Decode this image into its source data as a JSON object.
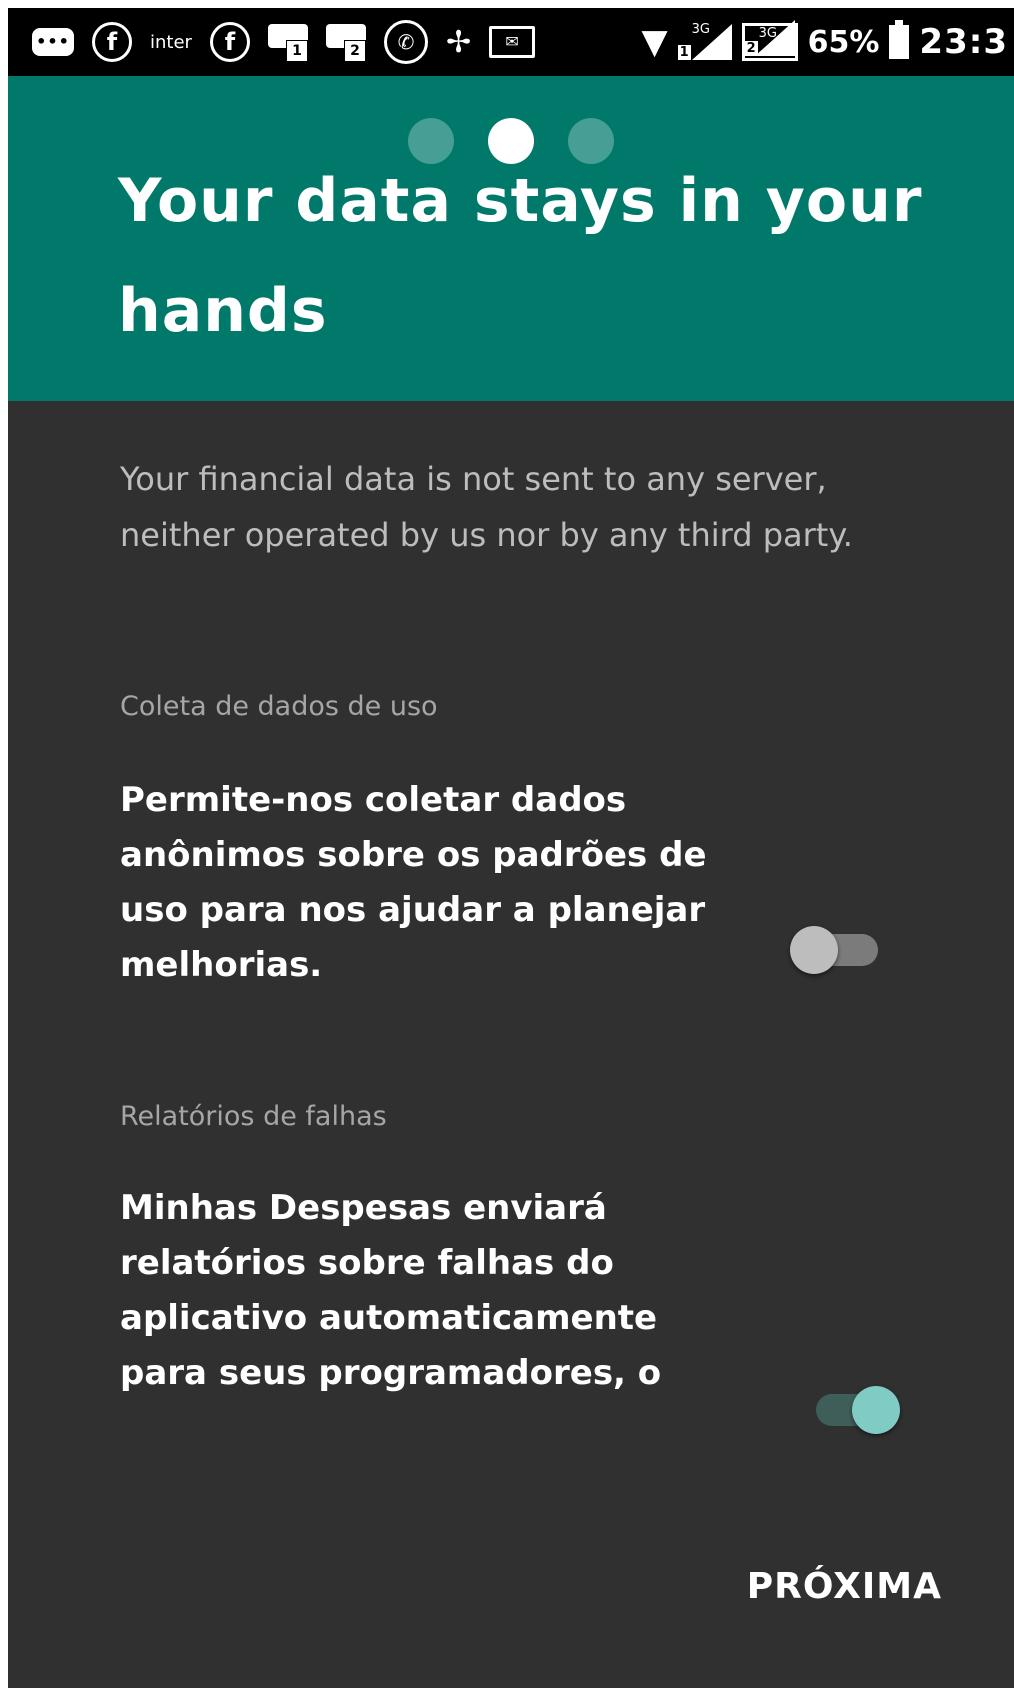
{
  "status_bar": {
    "icons_left": [
      "chat-bubble-icon",
      "facebook-icon",
      "inter-icon",
      "facebook-icon",
      "sms-sim1-icon",
      "sms-sim2-icon",
      "whatsapp-icon",
      "pinwheel-icon",
      "mail-icon"
    ],
    "inter_label": "inter",
    "sim1_label": "1",
    "sim2_label": "2",
    "network_label_1": "3G",
    "network_label_2": "3G",
    "battery_percent": "65%",
    "time": "23:3"
  },
  "onboarding": {
    "page_count": 3,
    "active_page": 2,
    "title": "Your data stays in your hands",
    "intro": "Your financial data is not sent to any server, neither operated by us nor by any third party.",
    "usage_data": {
      "label": "Coleta de dados de uso",
      "description": "Permite-nos coletar dados anônimos sobre os padrões de uso para nos ajudar a planejar melhorias.",
      "enabled": false
    },
    "crash_reports": {
      "label": "Relatórios de falhas",
      "description": "Minhas Despesas enviará relatórios sobre falhas do aplicativo automaticamente para seus programadores, o",
      "enabled": true
    },
    "next_label": "PRÓXIMA"
  },
  "colors": {
    "header_bg": "#00796b",
    "body_bg": "#303030",
    "switch_on": "#80cbc4"
  }
}
